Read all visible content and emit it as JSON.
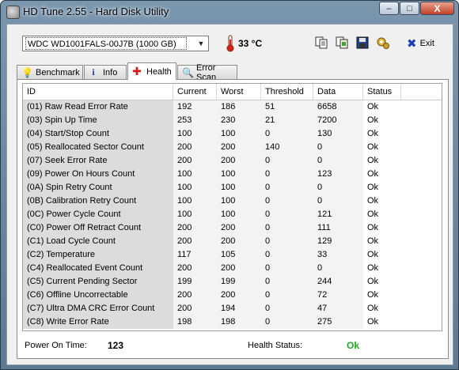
{
  "window": {
    "title": "HD Tune 2.55 - Hard Disk Utility",
    "buttons": {
      "minimize": "–",
      "maximize": "□",
      "close": "X"
    }
  },
  "toolbar": {
    "drive": "WDC WD1001FALS-00J7B (1000 GB)",
    "temperature": "33 °C",
    "exit_label": "Exit"
  },
  "tabs": [
    {
      "label": "Benchmark",
      "icon": "benchmark-icon"
    },
    {
      "label": "Info",
      "icon": "info-icon"
    },
    {
      "label": "Health",
      "icon": "health-icon",
      "active": true
    },
    {
      "label": "Error Scan",
      "icon": "error-scan-icon"
    }
  ],
  "table": {
    "columns": [
      "ID",
      "Current",
      "Worst",
      "Threshold",
      "Data",
      "Status"
    ],
    "rows": [
      [
        "(01) Raw Read Error Rate",
        "192",
        "186",
        "51",
        "6658",
        "Ok"
      ],
      [
        "(03) Spin Up Time",
        "253",
        "230",
        "21",
        "7200",
        "Ok"
      ],
      [
        "(04) Start/Stop Count",
        "100",
        "100",
        "0",
        "130",
        "Ok"
      ],
      [
        "(05) Reallocated Sector Count",
        "200",
        "200",
        "140",
        "0",
        "Ok"
      ],
      [
        "(07) Seek Error Rate",
        "200",
        "200",
        "0",
        "0",
        "Ok"
      ],
      [
        "(09) Power On Hours Count",
        "100",
        "100",
        "0",
        "123",
        "Ok"
      ],
      [
        "(0A) Spin Retry Count",
        "100",
        "100",
        "0",
        "0",
        "Ok"
      ],
      [
        "(0B) Calibration Retry Count",
        "100",
        "100",
        "0",
        "0",
        "Ok"
      ],
      [
        "(0C) Power Cycle Count",
        "100",
        "100",
        "0",
        "121",
        "Ok"
      ],
      [
        "(C0) Power Off Retract Count",
        "200",
        "200",
        "0",
        "111",
        "Ok"
      ],
      [
        "(C1) Load Cycle Count",
        "200",
        "200",
        "0",
        "129",
        "Ok"
      ],
      [
        "(C2) Temperature",
        "117",
        "105",
        "0",
        "33",
        "Ok"
      ],
      [
        "(C4) Reallocated Event Count",
        "200",
        "200",
        "0",
        "0",
        "Ok"
      ],
      [
        "(C5) Current Pending Sector",
        "199",
        "199",
        "0",
        "244",
        "Ok"
      ],
      [
        "(C6) Offline Uncorrectable",
        "200",
        "200",
        "0",
        "72",
        "Ok"
      ],
      [
        "(C7) Ultra DMA CRC Error Count",
        "200",
        "194",
        "0",
        "47",
        "Ok"
      ],
      [
        "(C8) Write Error Rate",
        "198",
        "198",
        "0",
        "275",
        "Ok"
      ]
    ]
  },
  "footer": {
    "power_on_label": "Power On Time:",
    "power_on_value": "123",
    "health_label": "Health Status:",
    "health_value": "Ok"
  },
  "colors": {
    "health_ok": "#1faa1f",
    "exit_x": "#1a3fb3"
  }
}
